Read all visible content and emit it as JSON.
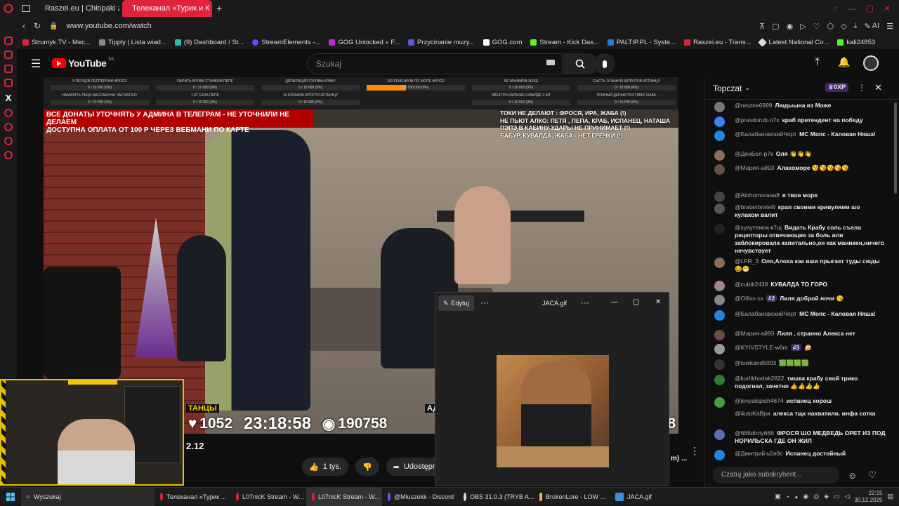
{
  "browser": {
    "tabs": [
      {
        "label": "Raszei.eu | Chłopaki z Ras"
      },
      {
        "label": "Телеканал «Турик и К"
      }
    ],
    "url": "www.youtube.com/watch",
    "ai_label": "AI",
    "bookmarks": [
      {
        "label": "Strumyk.TV - Mec...",
        "color": "#e0223a"
      },
      {
        "label": "Tipply | Lista wiad...",
        "color": "#888888"
      },
      {
        "label": "(9) Dashboard / St...",
        "color": "#22c3b5"
      },
      {
        "label": "StreamElements -...",
        "color": "#6b47ff"
      },
      {
        "label": "GOG Unlocked » F...",
        "color": "#c026d3"
      },
      {
        "label": "Przycinanie muzy...",
        "color": "#5b5bd6"
      },
      {
        "label": "GOG.com",
        "color": "#ffffff"
      },
      {
        "label": "Stream - Kick Das...",
        "color": "#53fc18"
      },
      {
        "label": "PALTIP.PL - Syste...",
        "color": "#2a7bde"
      },
      {
        "label": "Raszei.eu - Trans...",
        "color": "#e0223a"
      },
      {
        "label": "Latest National Co...",
        "color": "#dddddd"
      },
      {
        "label": "kali24853",
        "color": "#53fc18"
      }
    ]
  },
  "youtube": {
    "logo_text": "YouTube",
    "logo_region": "DK",
    "search_placeholder": "Szukaj"
  },
  "video": {
    "top_rows": [
      [
        "5 ПЕРЦЕВ ПЕППЕРОНИ ФРОСЕ",
        "ОБРИТЬ БРОВИ СТАНКОМ ПЕПЕ",
        "ДЕПИЛЯЦИЯ ГОЛОВЫ КРАБУ",
        "100 РЕМЕНКОВ ПО ЖОПЕ ФРОСЕ",
        "50 ЗАЖИМОВ ЖЕКЕ",
        "СЫСТЬ 10 БАНОК ШПРОТОВ ИСПАНЦУ"
      ],
      [
        "0 / 10 000 (0%)",
        "0 / 10 000 (0%)",
        "0 / 10 000 (0%)",
        "0 / 100 000 (0%)",
        "0 / 10 000 (0%)",
        "0 / 10 000 (0%)"
      ],
      [
        "НАМАЗАТЬ ЛИЦО ВАССАБИ НА ЧАС ВАТЕКУ",
        "1 КГ САЛА ПЕПЕ",
        "10 КУЛАКОВ ФРОСТИ ИСПАНЦУ",
        "ЭЛЕКТРО КАРАОКЕ КУВАЛДЕ 3 ШТ",
        "ПОЛНЫЙ ДЕРЬМ ПОЧ ПИВО ЖАБЕ"
      ],
      [
        "0 / 10 000 (0%)",
        "0 / 10 000 (0%)",
        "0 / 10 000 (0%)",
        "0 / 10 000 (0%)",
        "0 / 10 000 (0%)"
      ]
    ],
    "red_banner_lines": [
      "ВСЕ ДОНАТЫ УТОЧНЯТЬ У АДМИНА В ТЕЛЕГРАМ - НЕ УТОЧНИЛИ НЕ ДЕЛАЕМ",
      "ДОСТУПНА ОПЛАТА ОТ 100 Р ЧЕРЕЗ ВЕБМАНИ ПО КАРТЕ"
    ],
    "right_note_lines": [
      "ТОКИ НЕ ДЕЛАЮТ : ФРОСЯ, ИРА, ЖАБА (!)",
      "НЕ ПЬЮТ АЛКО: ПЕТЯ , ПЕПА, КРАБ, ИСПАНЕЦ, НАТАША",
      "ПЭПЭ В КАБИНУ УДАРЫ НЕ ПРИНИМАЕТ (!)",
      "БАБУР, КУВАЛДА, ЖАБА - НЕТ ГРЕЧКИ (!)"
    ],
    "dance_label": "ТАНЦЫ",
    "likes_count": "1052",
    "clock": "23:18:58",
    "views_count": "190758",
    "left_edge_digit": "8",
    "right_edge_digit": "8",
    "corner_label": "АД"
  },
  "below_video": {
    "title_fragment": "2.12",
    "like_label": "1 tys.",
    "share_label": "Udostępnij",
    "right_fragment": "m) ..."
  },
  "gif_window": {
    "edit_label": "Edytuj",
    "title": "JACA.gif"
  },
  "chat": {
    "header": "Topczat",
    "points_badge": "0XP",
    "messages": [
      {
        "author": "@neutne6999",
        "text": "Людыына из Може",
        "avatar_color": "#777777"
      },
      {
        "author": "@pravdorub-o7x",
        "text": "краб претендент на победу",
        "avatar_color": "#3b82f6"
      },
      {
        "author": "@БалабановскийЧорт",
        "text": "МС Мопс - Каловая Няша!",
        "avatar_color": "#1e88e5"
      },
      {
        "author": "@ДенБел-р7к",
        "text": "Оля 👋👋👋",
        "avatar_color": "#8d6e63"
      },
      {
        "author": "@Мария-ай93",
        "text": "Алахоморе 😘😘😘😘😘",
        "avatar_color": "#6d4c41"
      },
      {
        "author": "@Alohomoraaa8",
        "text": "я твое море",
        "avatar_color": "#444444"
      },
      {
        "author": "@bratanbratelli",
        "text": "крап своими кривулями шо кулаком валит",
        "avatar_color": "#555555"
      },
      {
        "author": "@хуаутемок-к7щ",
        "text": "Видать Крабу соль съела рецепторы отвечающие за боль или заблокировала капитально,он как маникен,ничего нечувствует",
        "avatar_color": "#222222"
      },
      {
        "author": "@LFR_3",
        "text": "Оля,Алоха как вши прыгает туды сюды 😂😁",
        "avatar_color": "#8e6b5a"
      },
      {
        "author": "@cubik2438",
        "text": "КУВАЛДА ТО ГОРО",
        "avatar_color": "#a1887f"
      },
      {
        "author": "@Olllxx-xx",
        "badge": "#2",
        "text": "Лиля доброй ночи 😘",
        "avatar_color": "#888888"
      },
      {
        "author": "@БалабановскийЧорт",
        "text": "МС Мопс - Каловая Няша!",
        "avatar_color": "#1e88e5"
      },
      {
        "author": "@Мария-ай93",
        "text": "Лиля , странно Алекса нет",
        "avatar_color": "#6d4c41"
      },
      {
        "author": "@KYIVSTYLE-w6m",
        "badge": "#3",
        "text": "🍰",
        "avatar_color": "#999999"
      },
      {
        "author": "@tuwkand5003",
        "text": "🟩🟩🟩🟩",
        "avatar_color": "#333333"
      },
      {
        "author": "@kurlikhodak2822",
        "text": "тишка крабу свой трико подогнал, зачетно 👍👍👍👍",
        "avatar_color": "#2e7d32"
      },
      {
        "author": "@jenyakipish4674",
        "text": "испанец хорош",
        "avatar_color": "#43a047"
      },
      {
        "author": "@4utoKaBpa",
        "text": "алекса тщк нахватили. инфа сотка",
        "avatar_color": "#111111"
      },
      {
        "author": "@666dirrty666",
        "text": "ФРОСЯ ШО МЕДВЕДЬ ОРЕТ ИЗ ПОД НОРИЛЬСКА ГДЕ ОН ЖИЛ",
        "avatar_color": "#5c6bc0"
      },
      {
        "author": "@Дмитрий-ь5я9с",
        "text": "Испанец достойный",
        "avatar_color": "#1e88e5"
      }
    ],
    "input_placeholder": "Czatuj jako subskrybent..."
  },
  "taskbar": {
    "search_label": "Wyszukaj",
    "items": [
      {
        "label": "Телеканал «Турик ..."
      },
      {
        "label": "L07nicK Stream - W..."
      },
      {
        "label": "L07nicK Stream - W..."
      },
      {
        "label": "@Miuszekk - Discord"
      },
      {
        "label": "OBS 31.0.3 (TRYB A..."
      },
      {
        "label": "BrokenLore - LOW ..."
      },
      {
        "label": "JACA.gif"
      }
    ],
    "time": "22:15",
    "date": "30.12.2025"
  }
}
